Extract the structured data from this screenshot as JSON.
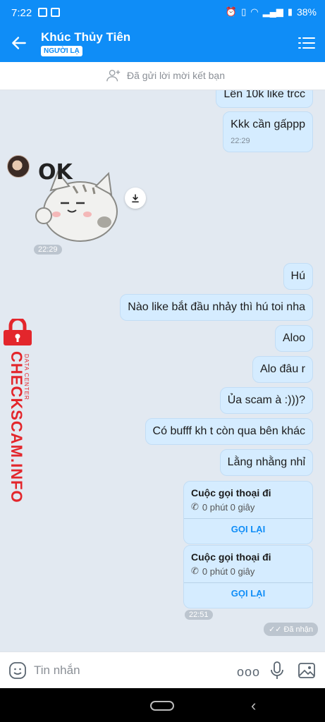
{
  "status_bar": {
    "time": "7:22",
    "battery": "38%"
  },
  "header": {
    "contact_name": "Khúc Thủy Tiên",
    "badge": "NGƯỜI LẠ"
  },
  "friend_request": {
    "text": "Đã gửi lời mời kết bạn"
  },
  "messages": [
    {
      "text": "Lên 10k like trcc"
    },
    {
      "text": "Kkk cần gấppp",
      "time": "22:29"
    },
    {
      "sticker_text": "OK",
      "time": "22:29"
    },
    {
      "text": "Hú"
    },
    {
      "text": "Nào like bắt đầu nhảy thì hú toi nha"
    },
    {
      "text": "Aloo"
    },
    {
      "text": "Alo đâu r"
    },
    {
      "text": "Ủa scam à :)))?"
    },
    {
      "text": "Có bufff kh t còn qua bên khác"
    },
    {
      "text": "Lằng nhằng nhỉ"
    }
  ],
  "calls": [
    {
      "title": "Cuộc gọi thoại đi",
      "detail": "0 phút 0 giây",
      "action": "GỌI LẠI"
    },
    {
      "title": "Cuộc gọi thoại đi",
      "detail": "0 phút 0 giây",
      "action": "GỌI LẠI"
    }
  ],
  "last_time": "22:51",
  "received_status": "Đã nhận",
  "watermark": {
    "brand": "CHECKSCAM.INFO",
    "sub": "DATA CENTER"
  },
  "input": {
    "placeholder": "Tin nhắn",
    "more": "ooo"
  },
  "colors": {
    "accent": "#0f8df7",
    "bubble": "#d5ecff",
    "background": "#e2e9f1",
    "watermark": "#e3262c"
  }
}
